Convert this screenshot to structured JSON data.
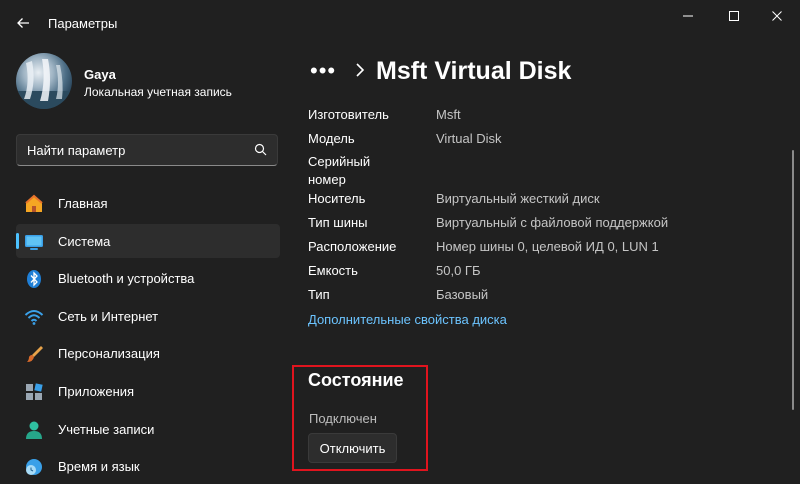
{
  "window": {
    "title": "Параметры",
    "controls": [
      "minimize-icon",
      "maximize-icon",
      "close-icon"
    ]
  },
  "user": {
    "name": "Gaya",
    "account_type": "Локальная учетная запись"
  },
  "search": {
    "placeholder": "Найти параметр"
  },
  "nav": {
    "items": [
      {
        "label": "Главная",
        "icon": "home-icon",
        "active": false
      },
      {
        "label": "Система",
        "icon": "system-icon",
        "active": true
      },
      {
        "label": "Bluetooth и устройства",
        "icon": "bluetooth-icon",
        "active": false
      },
      {
        "label": "Сеть и Интернет",
        "icon": "wifi-icon",
        "active": false
      },
      {
        "label": "Персонализация",
        "icon": "brush-icon",
        "active": false
      },
      {
        "label": "Приложения",
        "icon": "apps-icon",
        "active": false
      },
      {
        "label": "Учетные записи",
        "icon": "account-icon",
        "active": false
      },
      {
        "label": "Время и язык",
        "icon": "time-language-icon",
        "active": false
      }
    ]
  },
  "breadcrumb": {
    "overflow": "•••",
    "title": "Msft Virtual Disk"
  },
  "properties": [
    {
      "label": "Изготовитель",
      "value": "Msft"
    },
    {
      "label": "Модель",
      "value": "Virtual Disk"
    },
    {
      "label": "Серийный номер",
      "value": ""
    },
    {
      "label": "Носитель",
      "value": "Виртуальный жесткий диск"
    },
    {
      "label": "Тип шины",
      "value": "Виртуальный с файловой поддержкой"
    },
    {
      "label": "Расположение",
      "value": "Номер шины 0, целевой ИД 0, LUN 1"
    },
    {
      "label": "Емкость",
      "value": "50,0 ГБ"
    },
    {
      "label": "Тип",
      "value": "Базовый"
    }
  ],
  "link": {
    "label": "Дополнительные свойства диска"
  },
  "status": {
    "heading": "Состояние",
    "state": "Подключен",
    "button": "Отключить"
  },
  "colors": {
    "accent": "#4cc2ff",
    "link": "#6cc4ff",
    "highlight": "#e0141e",
    "background": "#202020"
  }
}
